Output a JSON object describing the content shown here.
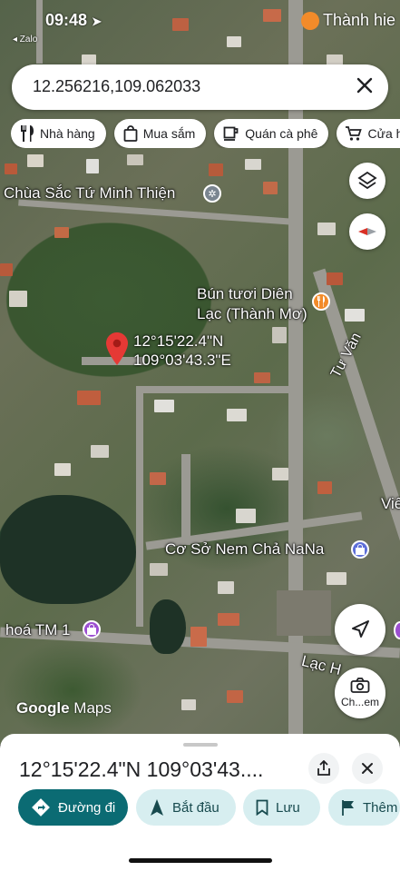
{
  "status_bar": {
    "time": "09:48",
    "back_app": "◂ Zalo",
    "right_app": "Thành hie"
  },
  "search": {
    "query": "12.256216,109.062033",
    "clear_icon": "close-icon"
  },
  "chips": [
    {
      "label": "Nhà hàng",
      "icon": "restaurant-icon"
    },
    {
      "label": "Mua sắm",
      "icon": "shopping-bag-icon"
    },
    {
      "label": "Quán cà phê",
      "icon": "coffee-icon"
    },
    {
      "label": "Cửa h",
      "icon": "cart-icon"
    }
  ],
  "map": {
    "labels": {
      "temple": "Chùa Sắc Tứ Minh Thiện",
      "restaurant_line1": "Bún tươi Diên",
      "restaurant_line2": "Lạc (Thành Mơ)",
      "street_tu_van": "Tư Văn",
      "street_vie": "Viê",
      "shop": "Cơ Sở Nem Chả NaNa",
      "store": "hoá TM 1",
      "street_lac": "Lạc H",
      "streetview": "Ch...em"
    },
    "pin": {
      "lat": "12°15'22.4\"N",
      "lng": "109°03'43.3\"E"
    },
    "logo": {
      "google": "Google",
      "maps": "Maps"
    },
    "colors": {
      "pin": "#e53935",
      "restaurant_poi": "#f28b2a",
      "shop_poi": "#5e6fd8",
      "store_poi": "#9c4fd1"
    }
  },
  "sheet": {
    "title": "12°15'22.4\"N 109°03'43....",
    "share_icon": "share-icon",
    "close_icon": "close-icon",
    "actions": [
      {
        "label": "Đường đi",
        "icon": "directions-icon"
      },
      {
        "label": "Bắt đầu",
        "icon": "navigation-arrow-icon"
      },
      {
        "label": "Lưu",
        "icon": "bookmark-icon"
      },
      {
        "label": "Thêm",
        "icon": "flag-icon"
      }
    ],
    "colors": {
      "primary": "#0b6b73",
      "secondary": "#d7eef0"
    }
  }
}
